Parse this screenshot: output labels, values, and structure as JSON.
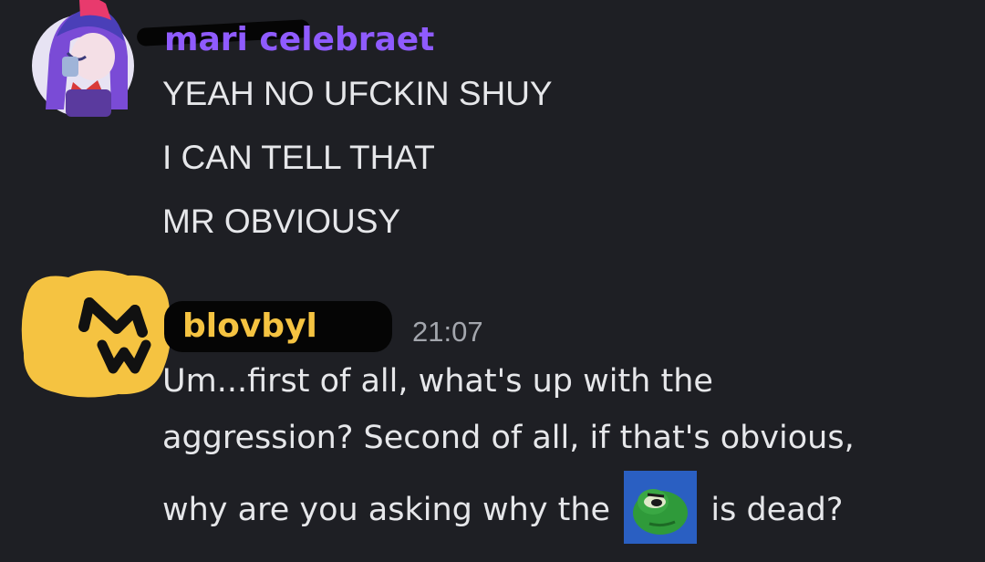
{
  "messages": [
    {
      "username": "mari celebraet",
      "username_color": "#8f5bff",
      "lines": [
        "YEAH NO UFCKIN SHUY",
        "I CAN TELL THAT",
        "MR OBVIOUSY"
      ]
    },
    {
      "username": "blovbyl",
      "username_color": "#f5c341",
      "timestamp": "21:07",
      "lines": [
        "Um...first of all, what's up with the",
        "aggression? Second of all, if that's obvious,"
      ],
      "last_line": {
        "before": "why are you asking why the",
        "emoji": "frog-emoji",
        "after": "is dead?"
      }
    }
  ],
  "colors": {
    "background": "#1e1f24",
    "text": "#e6e7ea",
    "timestamp": "#a3a6ad"
  }
}
